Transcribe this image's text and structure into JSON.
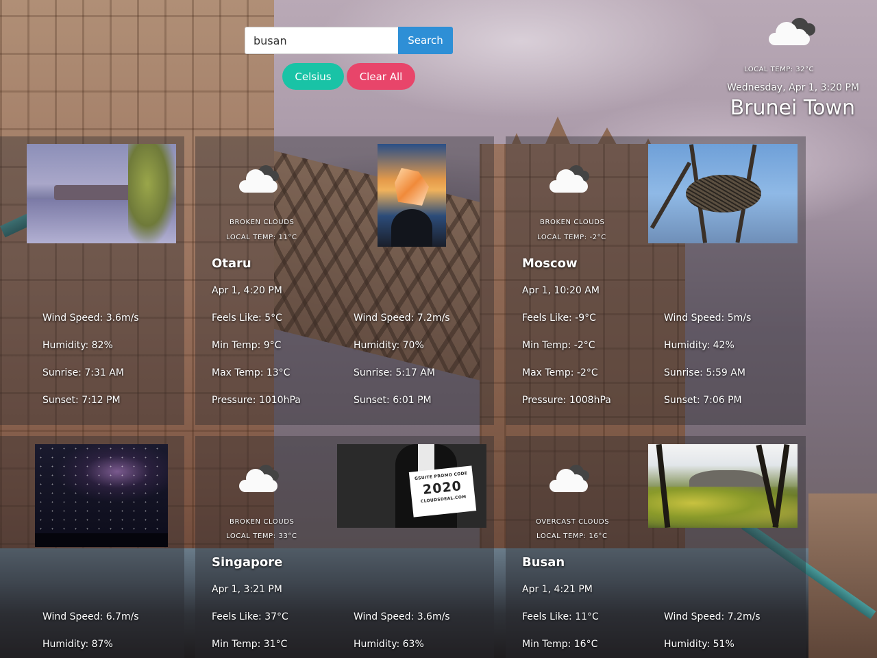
{
  "search": {
    "value": "busan",
    "button_label": "Search"
  },
  "controls": {
    "unit_toggle_label": "Celsius",
    "clear_label": "Clear All"
  },
  "current": {
    "icon": "cloud-icon",
    "local_temp": "LOCAL TEMP: 32°C",
    "datetime": "Wednesday, Apr 1, 3:20 PM",
    "city": "Brunei Town"
  },
  "cards": [
    {
      "stats_right": [
        "Wind Speed: 3.6m/s",
        "Humidity: 82%",
        "Sunrise: 7:31 AM",
        "Sunset: 7:12 PM"
      ]
    },
    {
      "icon": "cloud-icon",
      "description": "BROKEN CLOUDS",
      "local_temp": "LOCAL TEMP: 11°C",
      "city": "Otaru",
      "datetime": "Apr 1, 4:20 PM",
      "stats_left": [
        "Feels Like: 5°C",
        "Min Temp: 9°C",
        "Max Temp: 13°C",
        "Pressure: 1010hPa"
      ],
      "stats_right": [
        "Wind Speed: 7.2m/s",
        "Humidity: 70%",
        "Sunrise: 5:17 AM",
        "Sunset: 6:01 PM"
      ]
    },
    {
      "icon": "cloud-icon",
      "description": "BROKEN CLOUDS",
      "local_temp": "LOCAL TEMP: -2°C",
      "city": "Moscow",
      "datetime": "Apr 1, 10:20 AM",
      "stats_left": [
        "Feels Like: -9°C",
        "Min Temp: -2°C",
        "Max Temp: -2°C",
        "Pressure: 1008hPa"
      ],
      "stats_right": [
        "Wind Speed: 5m/s",
        "Humidity: 42%",
        "Sunrise: 5:59 AM",
        "Sunset: 7:06 PM"
      ]
    },
    {
      "stats_right": [
        "Wind Speed: 6.7m/s",
        "Humidity: 87%"
      ]
    },
    {
      "icon": "cloud-icon",
      "description": "BROKEN CLOUDS",
      "local_temp": "LOCAL TEMP: 33°C",
      "city": "Singapore",
      "datetime": "Apr 1, 3:21 PM",
      "stats_left": [
        "Feels Like: 37°C",
        "Min Temp: 31°C"
      ],
      "stats_right": [
        "Wind Speed: 3.6m/s",
        "Humidity: 63%"
      ],
      "photo_text": [
        "GSUITE PROMO CODE",
        "2020",
        "CLOUDSDEAL.COM"
      ]
    },
    {
      "icon": "cloud-icon",
      "description": "OVERCAST CLOUDS",
      "local_temp": "LOCAL TEMP: 16°C",
      "city": "Busan",
      "datetime": "Apr 1, 4:21 PM",
      "stats_left": [
        "Feels Like: 11°C",
        "Min Temp: 16°C"
      ],
      "stats_right": [
        "Wind Speed: 7.2m/s",
        "Humidity: 51%"
      ]
    }
  ]
}
